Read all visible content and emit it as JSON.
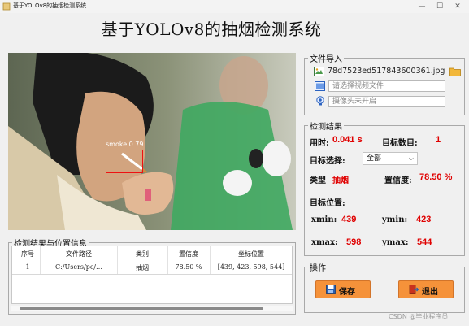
{
  "window": {
    "title": "基于YOLOv8的抽烟检测系统",
    "controls": {
      "minimize": "—",
      "maximize": "☐",
      "close": "✕"
    }
  },
  "app_title": "基于YOLOv8的抽烟检测系统",
  "detection_overlay": {
    "label": "smoke  0.79",
    "box_color": "#ee1111"
  },
  "results_table": {
    "legend": "检测结果与位置信息",
    "columns": [
      "序号",
      "文件路径",
      "类别",
      "置信度",
      "坐标位置"
    ],
    "rows": [
      [
        "1",
        "C:/Users/pc/…",
        "抽烟",
        "78.50 %",
        "[439, 423, 598, 544]"
      ]
    ]
  },
  "file_import": {
    "legend": "文件导入",
    "image_file": "78d7523ed517843600361.jpg",
    "video_placeholder": "请选择视频文件",
    "camera_placeholder": "摄像头未开启"
  },
  "detection_results": {
    "legend": "检测结果",
    "time_label": "用时:",
    "time_value": "0.041 s",
    "count_label": "目标数目:",
    "count_value": "1",
    "select_label": "目标选择:",
    "select_value": "全部",
    "type_label": "类型",
    "type_value": "抽烟",
    "conf_label": "置信度:",
    "conf_value": "78.50 %",
    "position_label": "目标位置:",
    "xmin_label": "xmin:",
    "xmin_value": "439",
    "ymin_label": "ymin:",
    "ymin_value": "423",
    "xmax_label": "xmax:",
    "xmax_value": "598",
    "ymax_label": "ymax:",
    "ymax_value": "544"
  },
  "actions": {
    "legend": "操作",
    "save_label": "保存",
    "exit_label": "退出",
    "button_color": "#f5923a"
  },
  "watermark": "CSDN @毕业程序员"
}
